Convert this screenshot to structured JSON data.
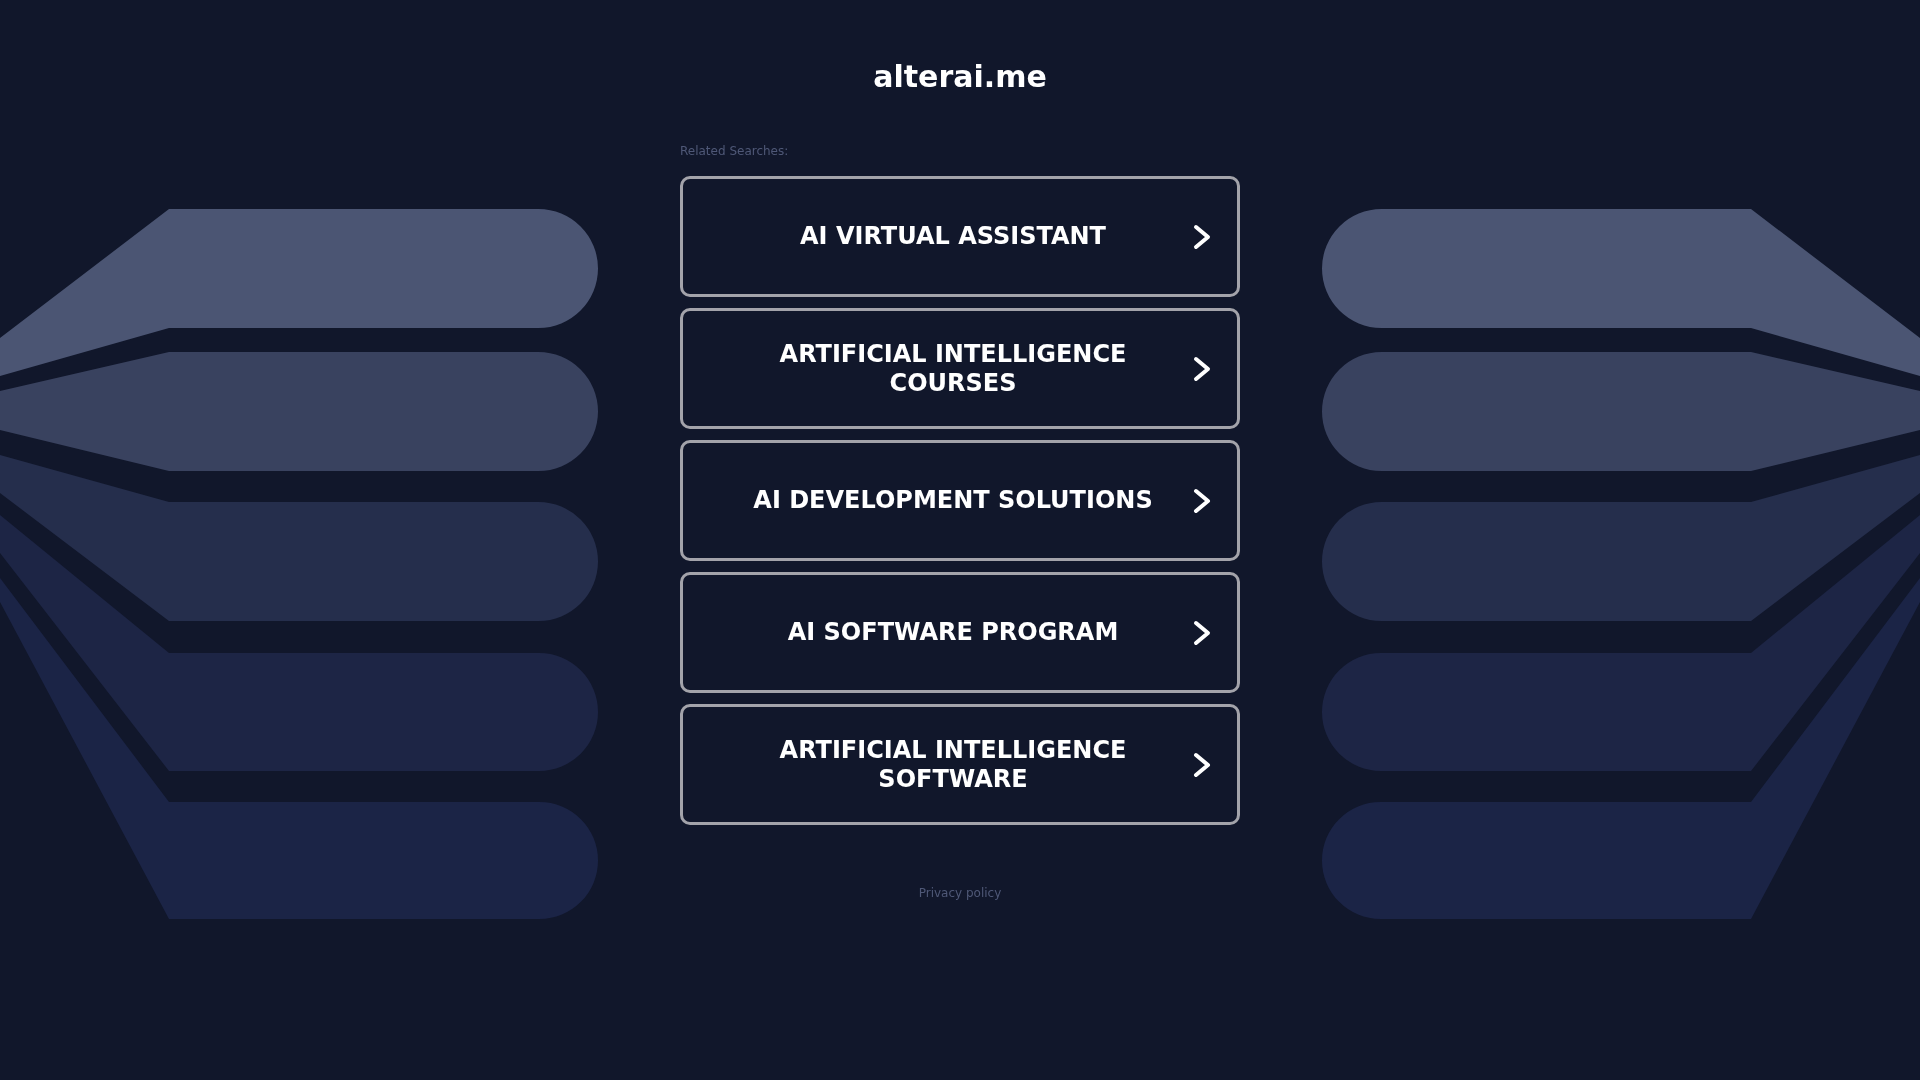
{
  "header": {
    "title": "alterai.me"
  },
  "related_searches": {
    "label": "Related Searches:",
    "items": [
      "AI VIRTUAL ASSISTANT",
      "ARTIFICIAL INTELLIGENCE COURSES",
      "AI DEVELOPMENT SOLUTIONS",
      "AI SOFTWARE PROGRAM",
      "ARTIFICIAL INTELLIGENCE SOFTWARE"
    ]
  },
  "footer": {
    "privacy_link": "Privacy policy"
  }
}
